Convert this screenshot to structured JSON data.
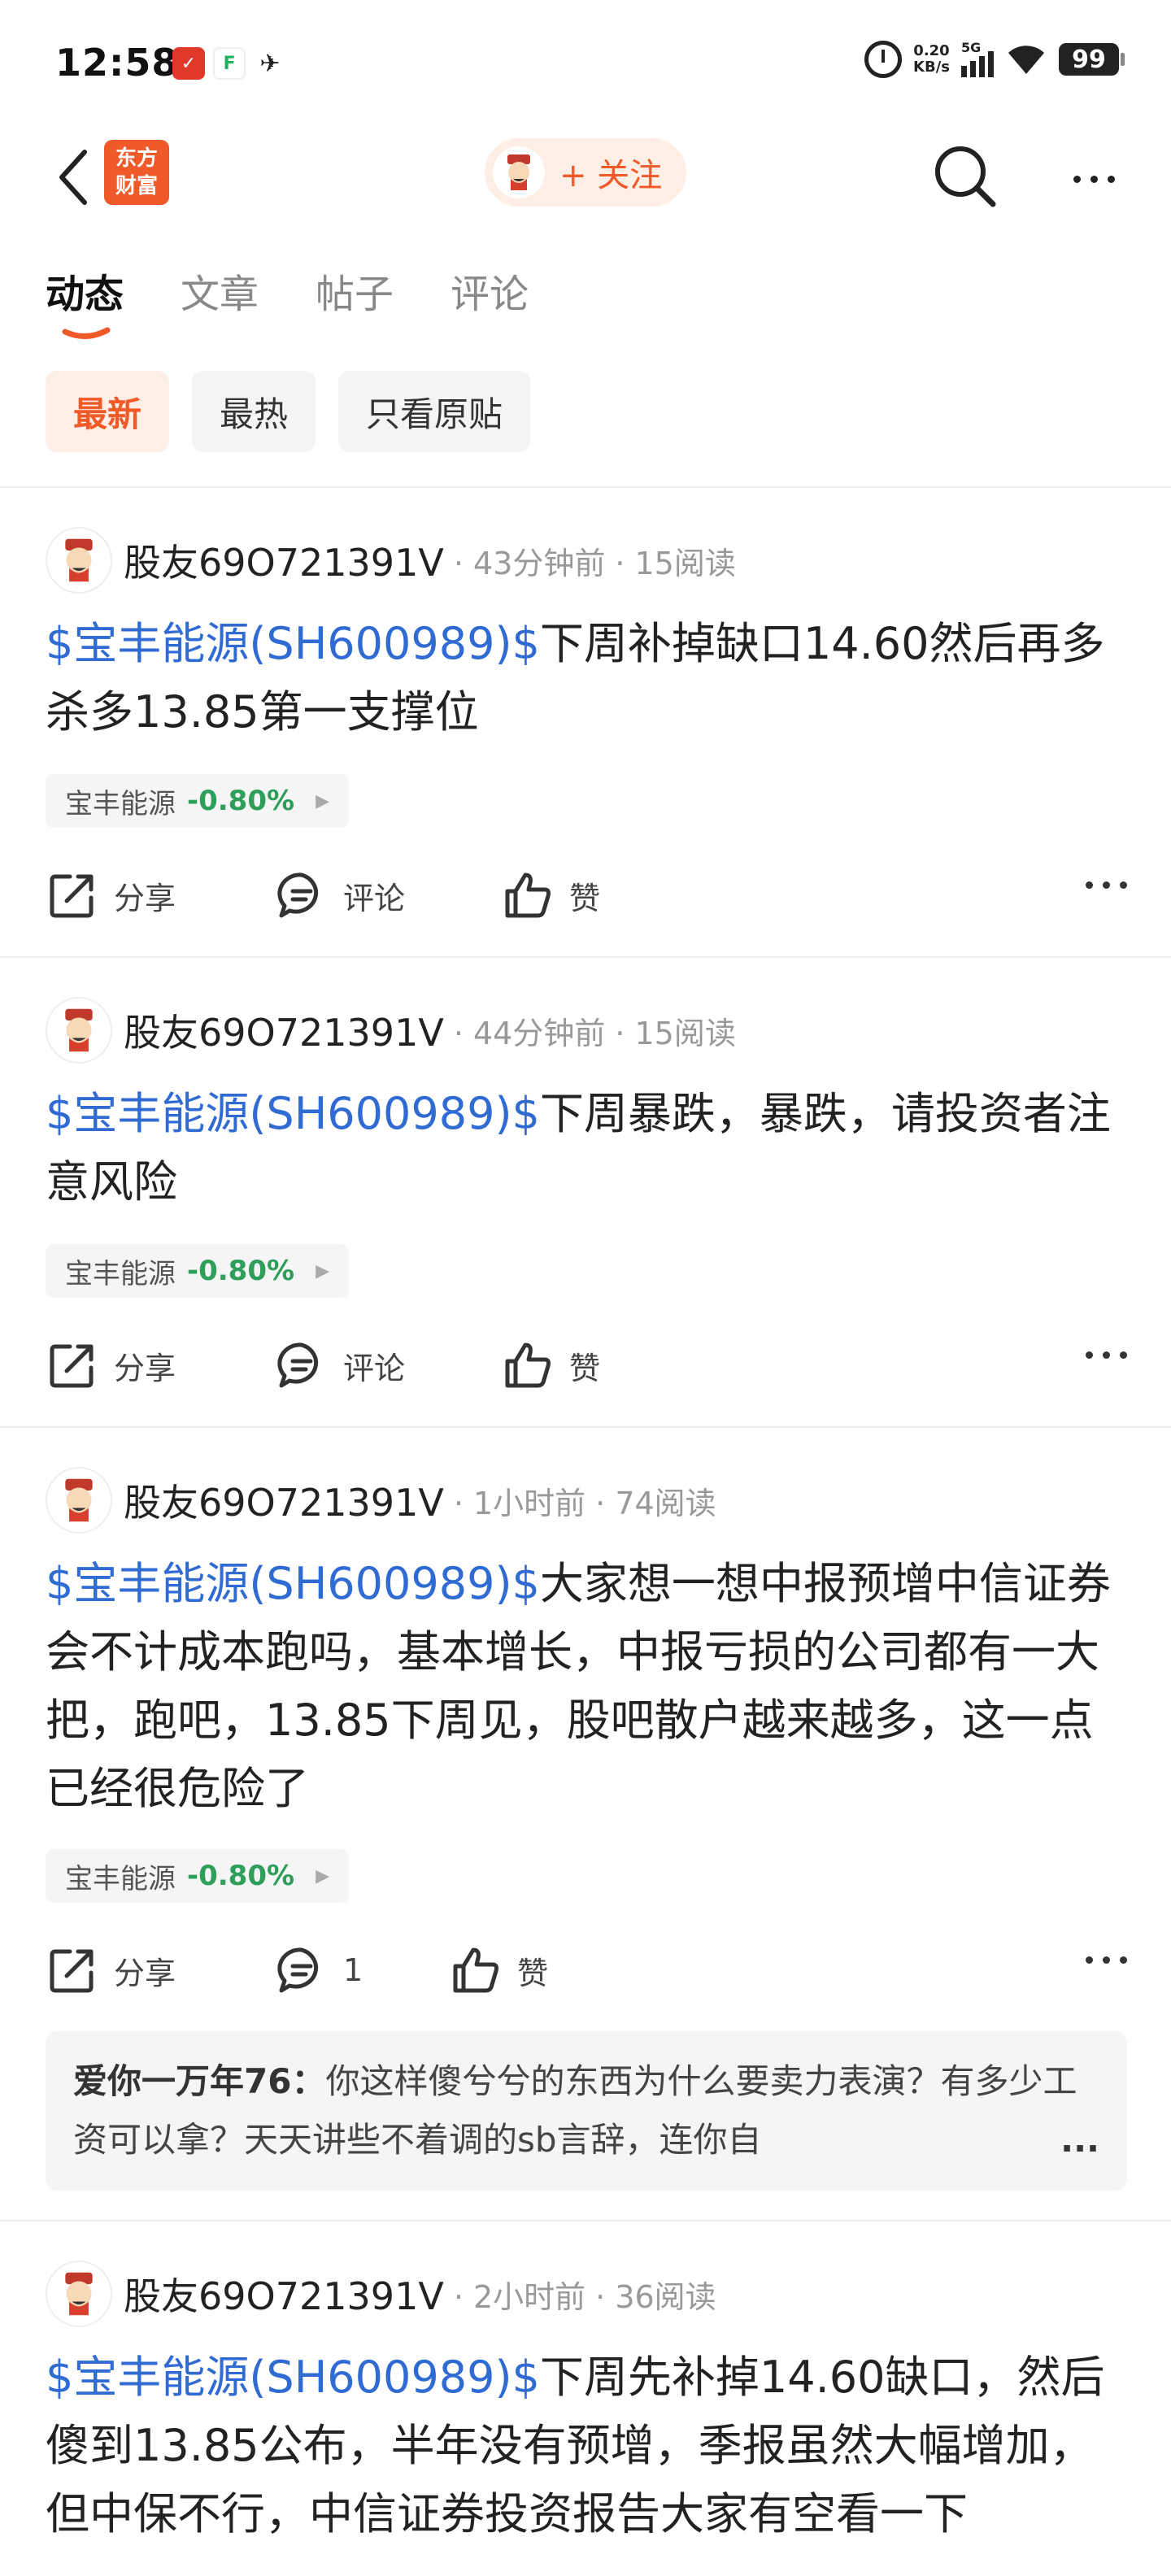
{
  "status": {
    "time": "12:58",
    "net_speed_value": "0.20",
    "net_speed_unit": "KB/s",
    "network": "5G",
    "battery": "99"
  },
  "header": {
    "logo_line1": "东方",
    "logo_line2": "财富",
    "follow_label": "+ 关注"
  },
  "tabs": [
    {
      "label": "动态"
    },
    {
      "label": "文章"
    },
    {
      "label": "帖子"
    },
    {
      "label": "评论"
    }
  ],
  "filters": [
    {
      "label": "最新"
    },
    {
      "label": "最热"
    },
    {
      "label": "只看原贴"
    }
  ],
  "actions": {
    "share": "分享",
    "comment": "评论",
    "like": "赞"
  },
  "posts": [
    {
      "author": "股友69O721391V",
      "time": "· 43分钟前",
      "reads": "· 15阅读",
      "tag": "$宝丰能源(SH600989)$",
      "text": "下周补掉缺口14.60然后再多杀多13.85第一支撑位",
      "stock": "宝丰能源",
      "change": "-0.80%",
      "comment_count": ""
    },
    {
      "author": "股友69O721391V",
      "time": "· 44分钟前",
      "reads": "· 15阅读",
      "tag": "$宝丰能源(SH600989)$",
      "text": "下周暴跌，暴跌，请投资者注意风险",
      "stock": "宝丰能源",
      "change": "-0.80%",
      "comment_count": ""
    },
    {
      "author": "股友69O721391V",
      "time": "· 1小时前",
      "reads": "· 74阅读",
      "tag": "$宝丰能源(SH600989)$",
      "text": "大家想一想中报预增中信证券会不计成本跑吗，基本增长，中报亏损的公司都有一大把，跑吧，13.85下周见，股吧散户越来越多，这一点已经很危险了",
      "stock": "宝丰能源",
      "change": "-0.80%",
      "comment_count": "1",
      "reply_user": "爱你一万年76：",
      "reply_text": "你这样傻兮兮的东西为什么要卖力表演？有多少工资可以拿？天天讲些不着调的sb言辞，连你自",
      "reply_more": "..."
    },
    {
      "author": "股友69O721391V",
      "time": "· 2小时前",
      "reads": "· 36阅读",
      "tag": "$宝丰能源(SH600989)$",
      "text": "下周先补掉14.60缺口，然后傻到13.85公布，半年没有预增，季报虽然大幅增加，但中保不行，中信证券投资报告大家有空看一下"
    }
  ],
  "colors": {
    "brand": "#f05a28",
    "link": "#2f6bd3",
    "down": "#2e9e5b"
  }
}
